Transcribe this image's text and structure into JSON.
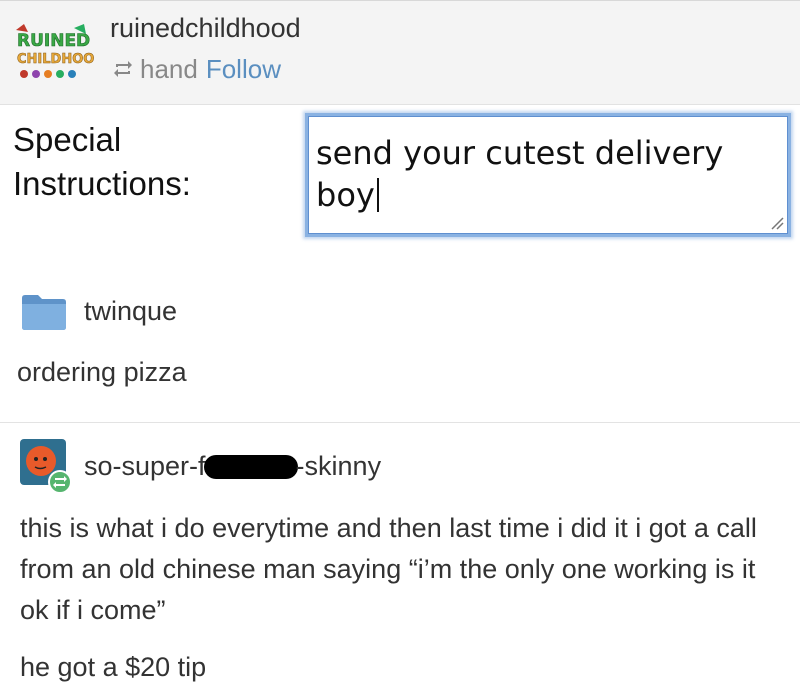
{
  "header": {
    "blog_name": "ruinedchildhood",
    "reblogged_from": "hand",
    "follow_label": "Follow",
    "logo_text": "RUINED CHILDHOOD"
  },
  "order_form": {
    "label": "Special\nInstructions:",
    "textarea_value": "send your cutest delivery boy"
  },
  "posts": [
    {
      "username": "twinque",
      "text": "ordering pizza"
    },
    {
      "username_prefix": "so-super-f",
      "username_suffix": "-skinny",
      "text": "this is what i do everytime and then last time i did it i got a call from an old chinese man saying “i’m the only one working is it ok if i come”",
      "text_2": "he got a $20 tip"
    }
  ],
  "colors": {
    "follow_link": "#5b8fc0",
    "textbox_border": "#8ab2e2",
    "header_bg": "#f4f4f4"
  }
}
